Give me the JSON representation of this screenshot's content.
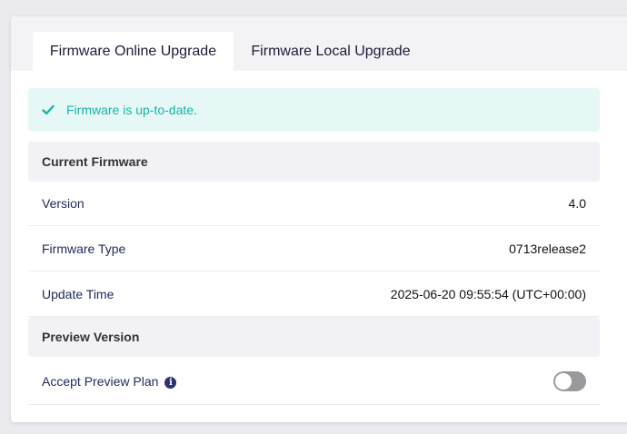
{
  "tabs": {
    "online": "Firmware Online Upgrade",
    "local": "Firmware Local Upgrade"
  },
  "alert": {
    "message": "Firmware is up-to-date.",
    "icon": "check-icon",
    "color": "#18b5a4"
  },
  "current_firmware": {
    "heading": "Current Firmware",
    "rows": [
      {
        "label": "Version",
        "value": "4.0"
      },
      {
        "label": "Firmware Type",
        "value": "0713release2"
      },
      {
        "label": "Update Time",
        "value": "2025-06-20 09:55:54 (UTC+00:00)"
      }
    ]
  },
  "preview": {
    "heading": "Preview Version",
    "accept_label": "Accept Preview Plan",
    "info_icon": "info-icon",
    "toggle_state": "off"
  }
}
